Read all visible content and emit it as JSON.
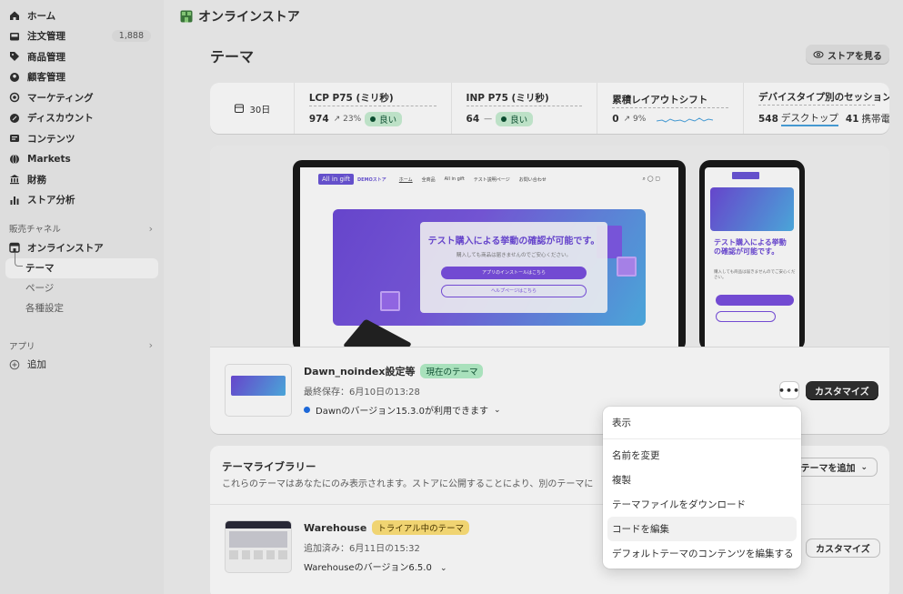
{
  "sidebar": {
    "items": [
      {
        "label": "ホーム",
        "icon": "home-icon"
      },
      {
        "label": "注文管理",
        "icon": "inbox-icon",
        "badge": "1,888"
      },
      {
        "label": "商品管理",
        "icon": "tag-icon"
      },
      {
        "label": "顧客管理",
        "icon": "person-icon"
      },
      {
        "label": "マーケティング",
        "icon": "target-icon"
      },
      {
        "label": "ディスカウント",
        "icon": "discount-icon"
      },
      {
        "label": "コンテンツ",
        "icon": "content-icon"
      },
      {
        "label": "Markets",
        "icon": "globe-icon"
      },
      {
        "label": "財務",
        "icon": "bank-icon"
      },
      {
        "label": "ストア分析",
        "icon": "chart-icon"
      }
    ],
    "sales_channels": {
      "heading": "販売チャネル",
      "online_store": "オンラインストア",
      "sub": [
        "テーマ",
        "ページ",
        "各種設定"
      ]
    },
    "apps": {
      "heading": "アプリ",
      "add": "追加"
    }
  },
  "header": {
    "store_title": "オンラインストア"
  },
  "page": {
    "title": "テーマ",
    "view_store": "ストアを見る"
  },
  "metrics": {
    "period": "30日",
    "lcp": {
      "label": "LCP P75 (ミリ秒)",
      "value": "974",
      "change": "23%",
      "status": "良い"
    },
    "inp": {
      "label": "INP P75 (ミリ秒)",
      "value": "64",
      "change": "—",
      "status": "良い"
    },
    "cls": {
      "label": "累積レイアウトシフト",
      "value": "0",
      "change": "9%"
    },
    "device": {
      "label": "デバイスタイプ別のセッション",
      "desktop_value": "548",
      "desktop_label": "デスクトップ",
      "mobile_value": "41",
      "mobile_label": "携帯電"
    }
  },
  "preview": {
    "logo": "All in gift",
    "store_name": "DEMOストア",
    "nav": [
      "ホーム",
      "全商品",
      "All in gift",
      "テスト説明ページ",
      "お問い合わせ"
    ],
    "hero_title": "テスト購入による挙動の確認が可能です。",
    "hero_sub": "購入しても商品は届きませんのでご安心ください。",
    "btn1": "アプリのインストールはこちら",
    "btn2": "ヘルプページはこちら",
    "phone_title": "テスト購入による挙動の確認が可能です。",
    "phone_sub": "購入しても商品は届きませんのでご安心ください。"
  },
  "current_theme": {
    "name": "Dawn_noindex設定等",
    "badge": "現在のテーマ",
    "saved": "最終保存：6月10日の13:28",
    "version": "Dawnのバージョン15.3.0が利用できます",
    "more": "•••",
    "customize": "カスタマイズ"
  },
  "library": {
    "title": "テーマライブラリー",
    "desc": "これらのテーマはあなたにのみ表示されます。ストアに公開することにより、別のテーマに",
    "add": "テーマを追加",
    "themes": [
      {
        "name": "Warehouse",
        "badge": "トライアル中のテーマ",
        "added": "追加済み：6月11日の15:32",
        "version": "Warehouseのバージョン6.5.0",
        "customize": "カスタマイズ"
      }
    ]
  },
  "menu": {
    "items": [
      "表示",
      "名前を変更",
      "複製",
      "テーマファイルをダウンロード",
      "コードを編集",
      "デフォルトテーマのコンテンツを編集する"
    ],
    "highlighted": "コードを編集"
  },
  "colors": {
    "accent": "#303030",
    "good": "#c9f0d4",
    "trial": "#ffe27a",
    "current": "#b4f0c8",
    "link": "#1f6fe6"
  }
}
